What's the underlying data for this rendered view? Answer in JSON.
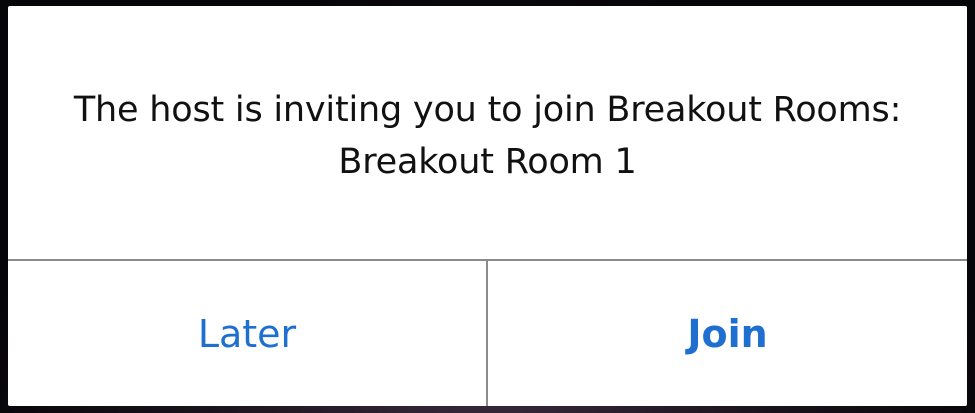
{
  "dialog": {
    "message_line1": "The host is inviting you to join Breakout Rooms:",
    "message_line2": "Breakout Room 1",
    "later_label": "Later",
    "join_label": "Join"
  },
  "colors": {
    "accent": "#1f6fd0",
    "text": "#111111",
    "divider": "#8c8c8c",
    "dialog_bg": "#ffffff"
  }
}
